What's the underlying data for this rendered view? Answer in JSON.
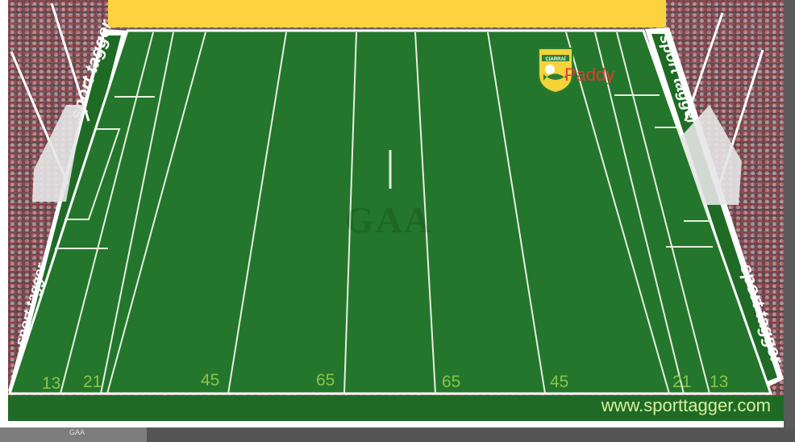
{
  "header": {
    "title": ""
  },
  "branding": {
    "ad_text": "sport tagger",
    "website": "www.sporttagger.com",
    "watermark": "GAA",
    "footer_label": "GAA"
  },
  "pitch": {
    "line_markers": [
      "13",
      "21",
      "45",
      "65",
      "65",
      "45",
      "21",
      "13"
    ]
  },
  "player": {
    "name": "Paddy",
    "crest_text": "CIARRAÍ"
  },
  "colors": {
    "pitch_green": "#23762b",
    "header_yellow": "#fcd23f",
    "line_white": "#e8efe0",
    "number_green": "#8bc34a",
    "player_name_red": "#e53935"
  }
}
